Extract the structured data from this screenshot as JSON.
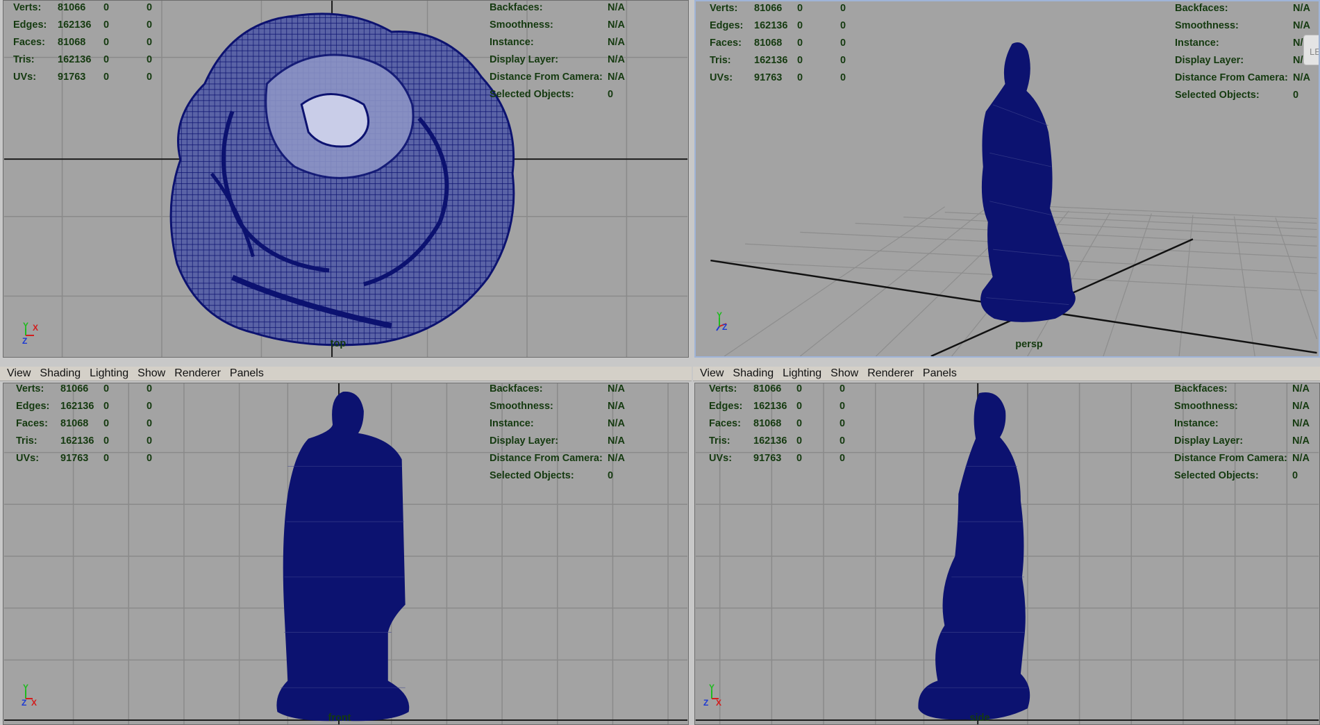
{
  "menu": [
    "View",
    "Shading",
    "Lighting",
    "Show",
    "Renderer",
    "Panels"
  ],
  "stats_left": [
    {
      "label": "Verts:",
      "v1": "81066",
      "v2": "0",
      "v3": "0"
    },
    {
      "label": "Edges:",
      "v1": "162136",
      "v2": "0",
      "v3": "0"
    },
    {
      "label": "Faces:",
      "v1": "81068",
      "v2": "0",
      "v3": "0"
    },
    {
      "label": "Tris:",
      "v1": "162136",
      "v2": "0",
      "v3": "0"
    },
    {
      "label": "UVs:",
      "v1": "91763",
      "v2": "0",
      "v3": "0"
    }
  ],
  "stats_right": [
    {
      "label": "Backfaces:",
      "value": "N/A"
    },
    {
      "label": "Smoothness:",
      "value": "N/A"
    },
    {
      "label": "Instance:",
      "value": "N/A"
    },
    {
      "label": "Display Layer:",
      "value": "N/A"
    },
    {
      "label": "Distance From Camera:",
      "value": "N/A"
    },
    {
      "label": "Selected Objects:",
      "value": "0"
    }
  ],
  "viewports": {
    "top": {
      "camera": "top"
    },
    "persp": {
      "camera": "persp"
    },
    "front": {
      "camera": "front"
    },
    "side": {
      "camera": "side"
    }
  },
  "side_tab_text": "LEFT",
  "colors": {
    "viewport_bg": "#a3a3a3",
    "wire": "#0c1270",
    "hud_text": "#153a10",
    "grid": "#8a8a8a",
    "axis_line": "#1a1a1a"
  },
  "icons": {
    "axis_indicator": "xyz-axis-icon"
  }
}
